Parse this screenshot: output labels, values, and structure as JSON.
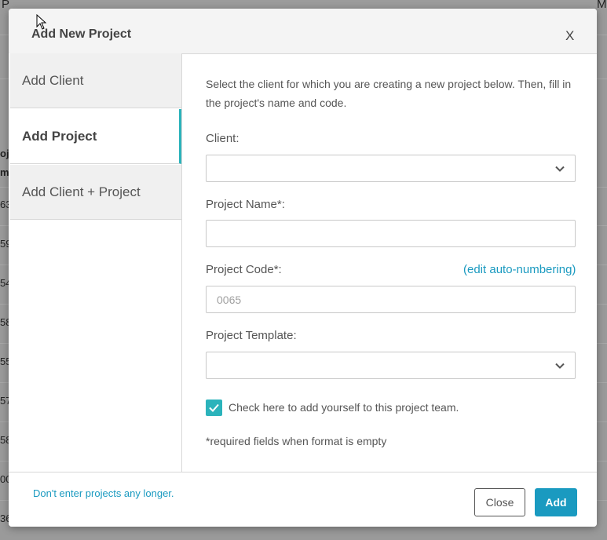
{
  "background": {
    "top_left_text": "P",
    "top_right_text": "MY",
    "row_cells": [
      "oj",
      "m",
      "63",
      "59",
      "54",
      "58",
      "55",
      "57",
      "58",
      "00",
      "36"
    ]
  },
  "modal": {
    "title": "Add New Project",
    "close_icon": "X",
    "sidebar": {
      "items": [
        {
          "label": "Add Client",
          "active": false
        },
        {
          "label": "Add Project",
          "active": true
        },
        {
          "label": "Add Client + Project",
          "active": false
        }
      ]
    },
    "form": {
      "intro": "Select the client for which you are creating a new project below. Then, fill in the project's name and code.",
      "client_label": "Client:",
      "client_value": "",
      "project_name_label": "Project Name*:",
      "project_name_value": "",
      "project_code_label": "Project Code*:",
      "edit_auto_numbering": "(edit auto-numbering)",
      "project_code_placeholder": "0065",
      "project_template_label": "Project Template:",
      "project_template_value": "",
      "team_checkbox_label": "Check here to add yourself to this project team.",
      "team_checkbox_checked": true,
      "required_note": "*required fields when format is empty"
    },
    "footer": {
      "link": "Don't enter projects any longer.",
      "close_button": "Close",
      "add_button": "Add"
    }
  },
  "colors": {
    "accent": "#2bb3bb",
    "link": "#1a9ac0",
    "primary_button": "#1a9ac0"
  }
}
